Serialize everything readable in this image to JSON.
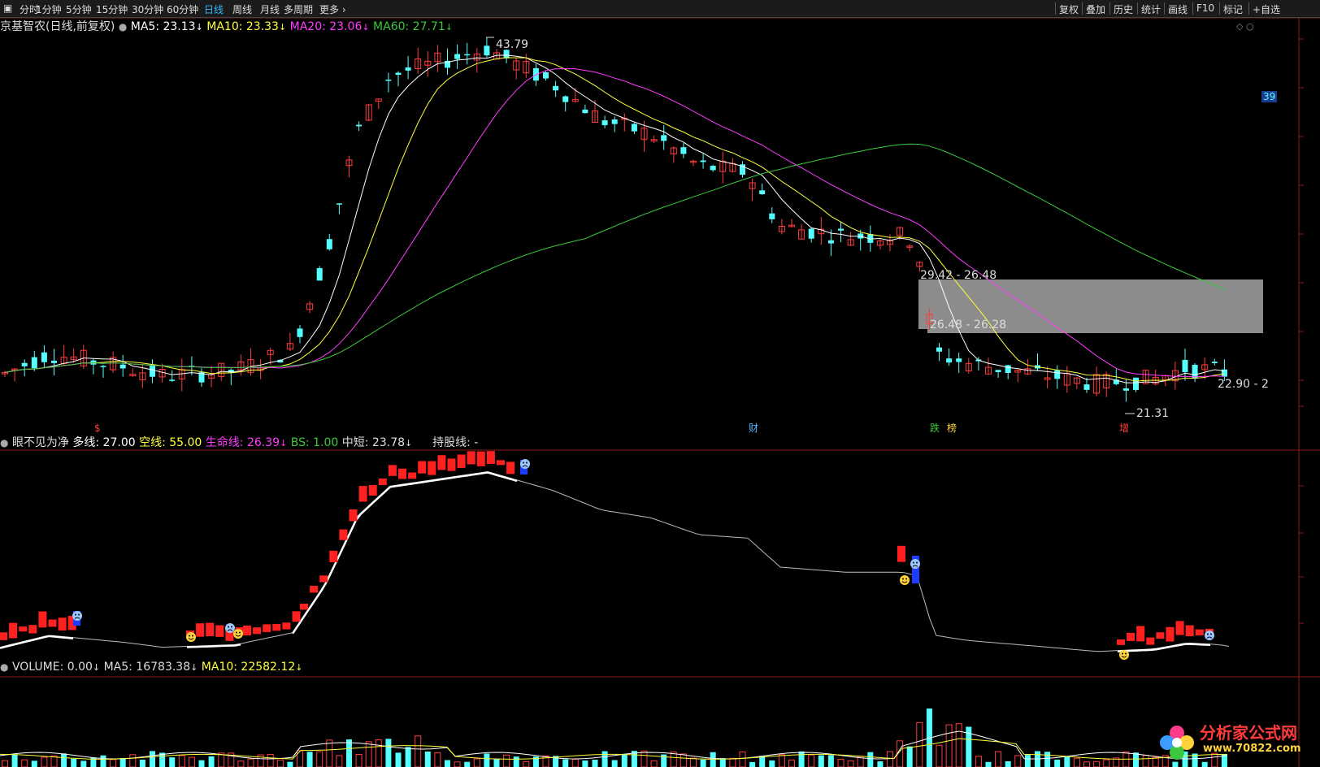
{
  "toolbar": {
    "periods": [
      "分时",
      "1分钟",
      "5分钟",
      "15分钟",
      "30分钟",
      "60分钟",
      "日线",
      "周线",
      "月线",
      "多周期",
      "更多"
    ],
    "active_period": "日线",
    "right_buttons": [
      "复权",
      "叠加",
      "历史",
      "统计",
      "画线",
      "F10",
      "标记",
      "+自选"
    ]
  },
  "main_panel": {
    "title": "京基智农(日线,前复权)",
    "ma5": "MA5: 23.13",
    "ma10": "MA10: 23.33",
    "ma20": "MA20: 23.06",
    "ma60": "MA60: 27.71",
    "arrow": "↓",
    "high_label": "43.79",
    "low_label": "21.31",
    "last_price_label": "22.90 - 2",
    "gap_upper_label": "29.42 - 26.48",
    "gap_lower_label": "26.48 - 26.28",
    "right_edge_badge": "39",
    "event_markers": [
      "$",
      "财",
      "跌",
      "榜",
      "增"
    ],
    "colors": {
      "ma5": "#ffffff",
      "ma10": "#ffff3c",
      "ma20": "#ff3cff",
      "ma60": "#3cc83c",
      "up": "#ff3c3c",
      "down": "#54ffff"
    }
  },
  "indicator_panel": {
    "name": "眼不见为净",
    "duo": "多线: 27.00",
    "kong": "空线: 55.00",
    "life": "生命线: 26.39",
    "bs": "BS: 1.00",
    "mid": "中短: 23.78",
    "hold": "持股线: -",
    "arrow": "↓"
  },
  "volume_panel": {
    "volume": "VOLUME: 0.00",
    "ma5": "MA5: 16783.38",
    "ma10": "MA10: 22582.12",
    "arrow": "↓"
  },
  "watermark": {
    "line1": "分析家公式网",
    "line2": "www.70822.com"
  }
}
